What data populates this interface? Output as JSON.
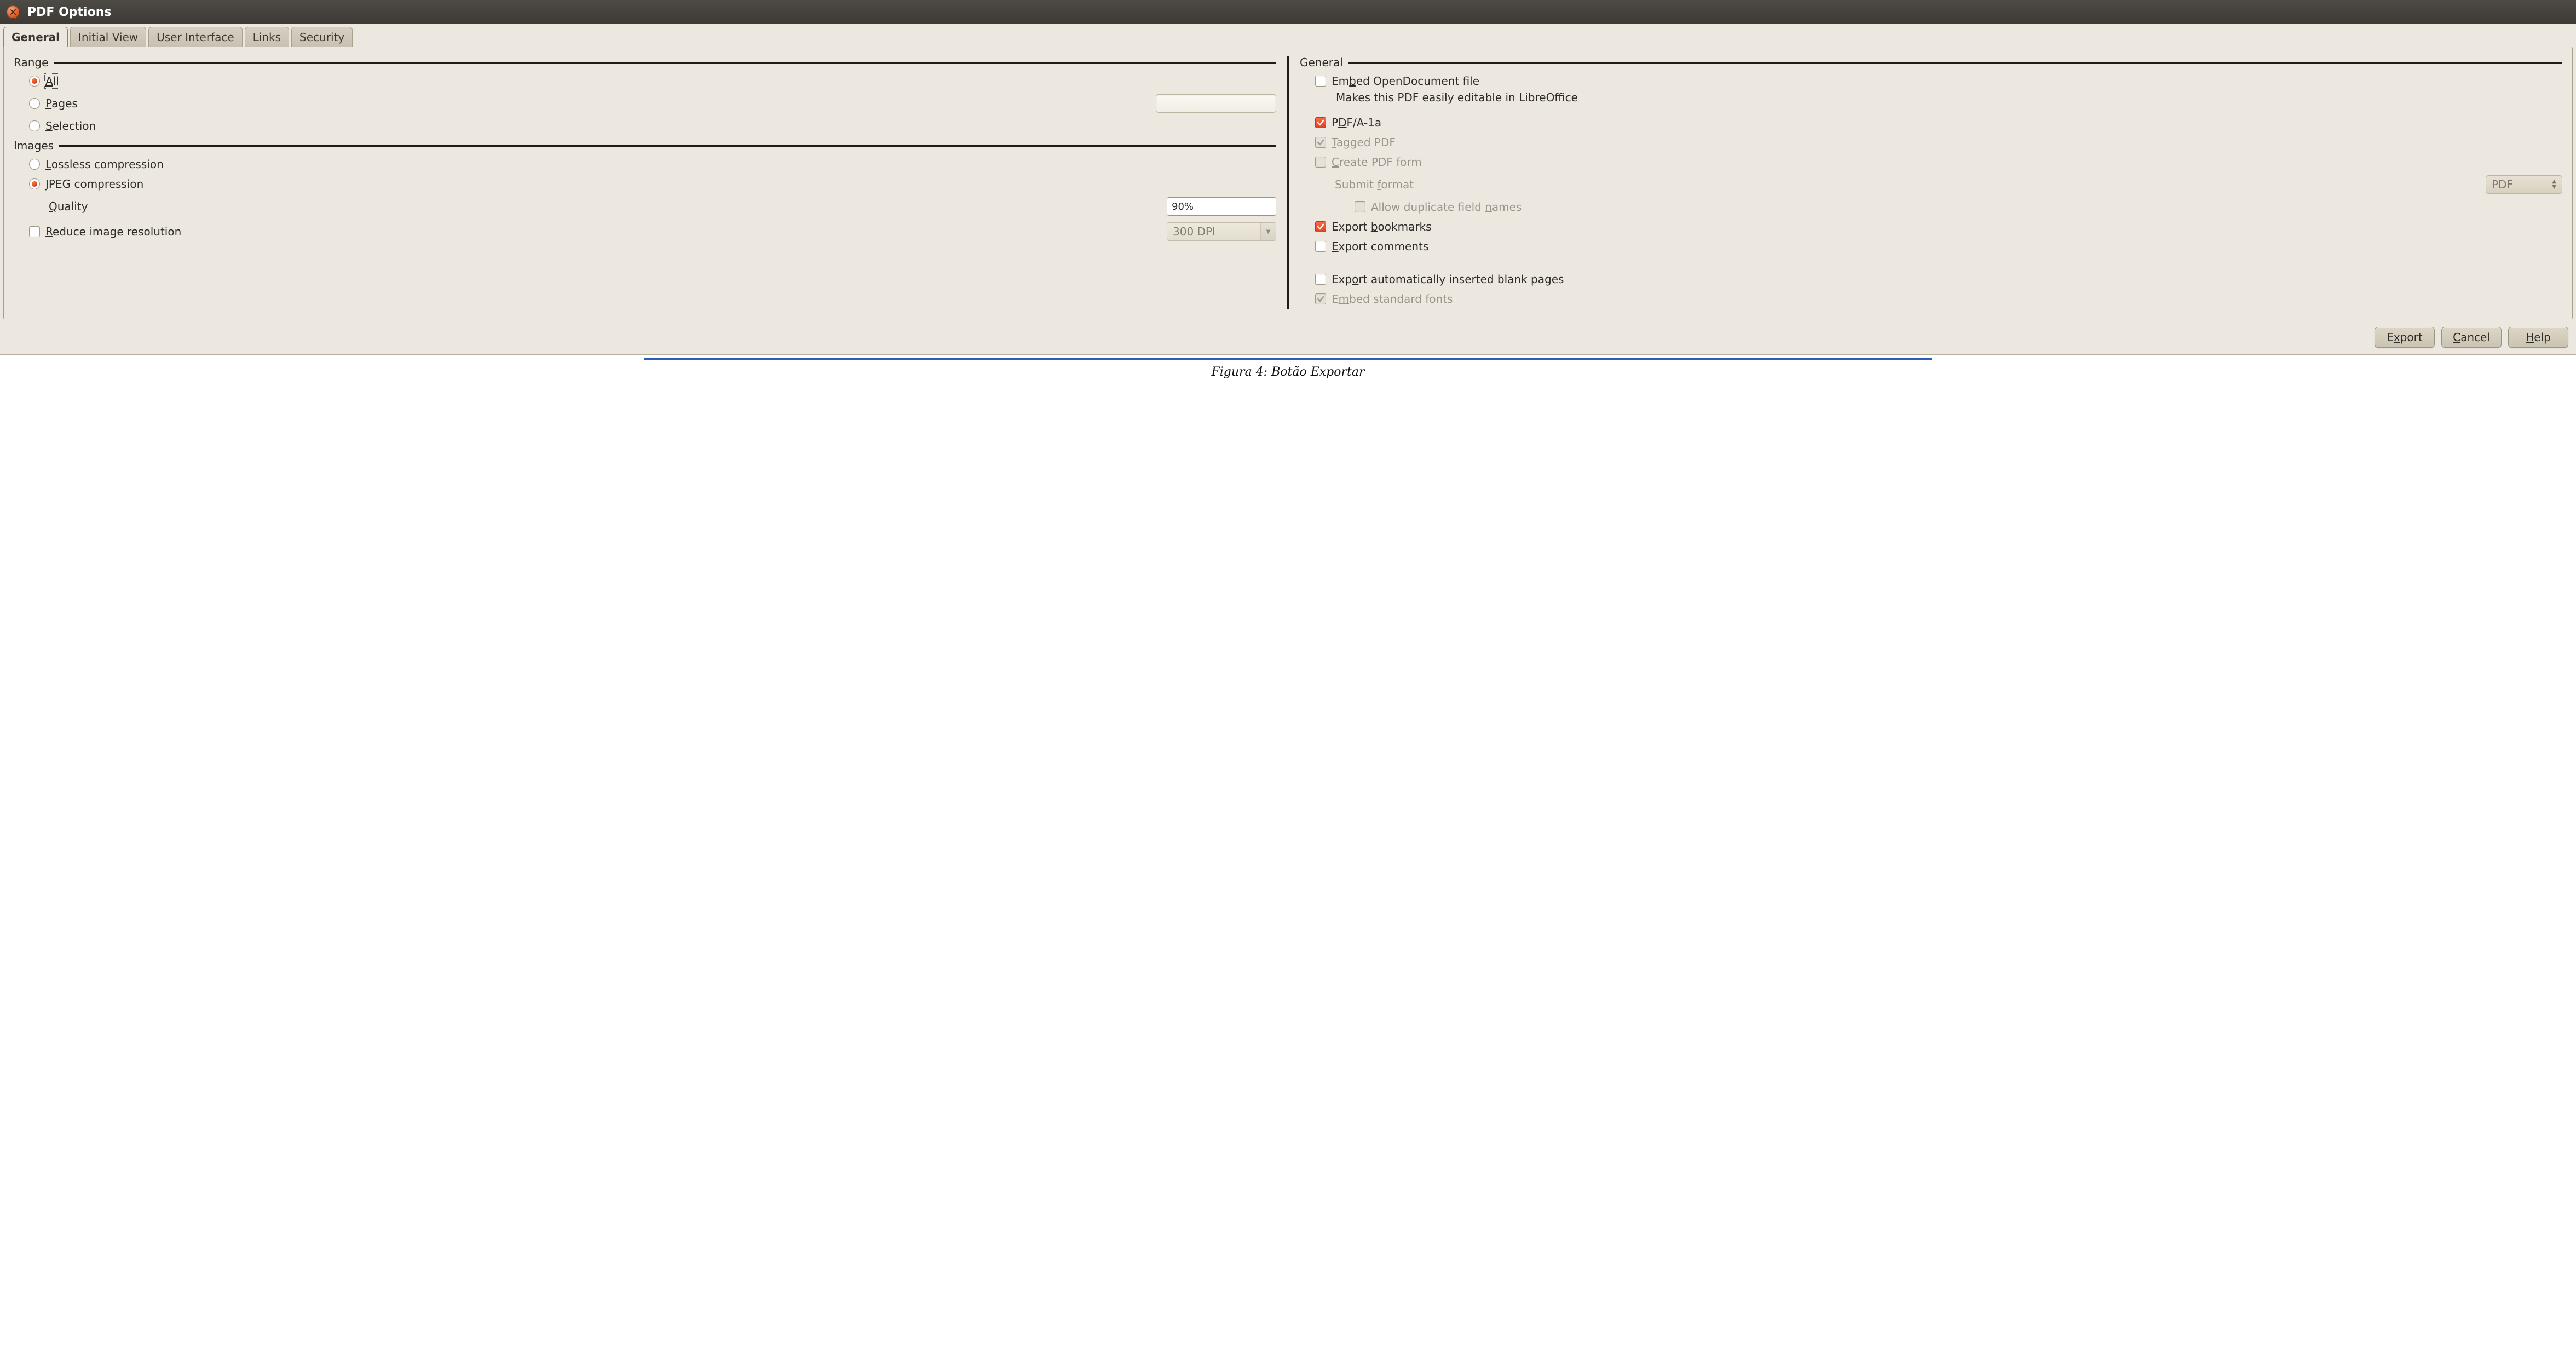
{
  "window": {
    "title": "PDF Options"
  },
  "tabs": {
    "t0": "General",
    "t1": "Initial View",
    "t2": "User Interface",
    "t3": "Links",
    "t4": "Security"
  },
  "left": {
    "range_heading": "Range",
    "all": "All",
    "pages": "Pages",
    "selection": "Selection",
    "images_heading": "Images",
    "lossless": "Lossless compression",
    "jpeg": "JPEG compression",
    "quality": "Quality",
    "quality_value": "90%",
    "reduce": "Reduce image resolution",
    "dpi_value": "300 DPI"
  },
  "right": {
    "general_heading": "General",
    "embed_odf": "Embed OpenDocument file",
    "embed_odf_hint": "Makes this PDF easily editable in LibreOffice",
    "pdfa": "PDF/A-1a",
    "tagged": "Tagged PDF",
    "create_form": "Create PDF form",
    "submit_format": "Submit format",
    "submit_format_value": "PDF",
    "allow_dup": "Allow duplicate field names",
    "export_bookmarks": "Export bookmarks",
    "export_comments": "Export comments",
    "export_blank": "Export automatically inserted blank pages",
    "embed_fonts": "Embed standard fonts"
  },
  "buttons": {
    "export": "Export",
    "cancel": "Cancel",
    "help": "Help"
  },
  "caption": "Figura 4: Botão Exportar"
}
